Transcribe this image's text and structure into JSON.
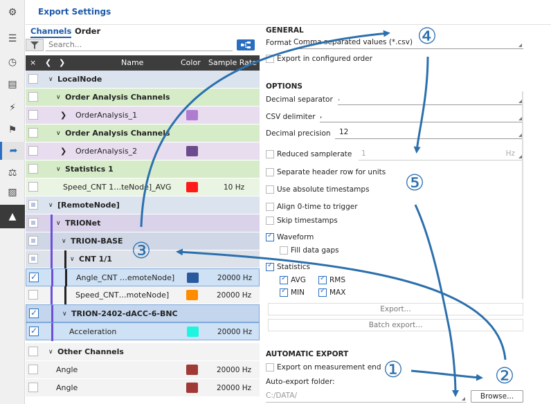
{
  "window": {
    "title": "Export Settings"
  },
  "sidebar": {
    "icons": [
      "gear-icon",
      "list-icon",
      "gauge-icon",
      "document-icon",
      "lightning-icon",
      "flag-icon",
      "export-icon",
      "network-icon",
      "car-icon",
      "triangle-icon"
    ]
  },
  "tabs": {
    "channels": "Channels",
    "order": "Order"
  },
  "search": {
    "placeholder": "Search..."
  },
  "table": {
    "headers": {
      "clear": "×",
      "name": "Name",
      "color": "Color",
      "rate": "Sample Rate"
    },
    "rows": [
      {
        "label": "LocalNode",
        "bold": true
      },
      {
        "label": "Order Analysis Channels",
        "bold": true
      },
      {
        "label": "OrderAnalysis_1",
        "color": "#b07cd0"
      },
      {
        "label": "Order Analysis Channels",
        "bold": true
      },
      {
        "label": "OrderAnalysis_2",
        "color": "#6b4a8e"
      },
      {
        "label": "Statistics 1",
        "bold": true
      },
      {
        "label": "Speed_CNT 1…teNode]_AVG",
        "color": "#ff1a1a",
        "rate": "10 Hz"
      },
      {
        "label": "[RemoteNode]",
        "bold": true
      },
      {
        "label": "TRIONet",
        "bold": true
      },
      {
        "label": "TRION-BASE",
        "bold": true
      },
      {
        "label": "CNT 1/1",
        "bold": true
      },
      {
        "label": "Angle_CNT …emoteNode]",
        "color": "#2a5a9e",
        "rate": "20000 Hz"
      },
      {
        "label": "Speed_CNT…moteNode]",
        "color": "#ff8c00",
        "rate": "20000 Hz"
      },
      {
        "label": "TRION-2402-dACC-6-BNC",
        "bold": true
      },
      {
        "label": "Acceleration",
        "color": "#1ef5e0",
        "rate": "20000 Hz"
      },
      {
        "label": "Other Channels",
        "bold": true
      },
      {
        "label": "Angle",
        "color": "#a03a36",
        "rate": "20000 Hz"
      },
      {
        "label": "Angle",
        "color": "#a03a36",
        "rate": "20000 Hz"
      }
    ]
  },
  "general": {
    "heading": "GENERAL",
    "format_label": "Format",
    "format_value": "Comma separated values (*.csv)",
    "export_order": "Export in configured order"
  },
  "options": {
    "heading": "OPTIONS",
    "decimal_separator_label": "Decimal separator",
    "decimal_separator_value": ".",
    "csv_delimiter_label": "CSV delimiter",
    "csv_delimiter_value": ",",
    "decimal_precision_label": "Decimal precision",
    "decimal_precision_value": "12",
    "reduced_samplerate": "Reduced samplerate",
    "reduced_value": "1",
    "reduced_unit": "Hz",
    "separate_header": "Separate header row for units",
    "absolute_ts": "Use absolute timestamps",
    "align_zero": "Align 0-time to trigger",
    "skip_ts": "Skip timestamps",
    "waveform": "Waveform",
    "fill_gaps": "Fill data gaps",
    "statistics": "Statistics",
    "avg": "AVG",
    "rms": "RMS",
    "min": "MIN",
    "max": "MAX",
    "export_btn": "Export...",
    "batch_btn": "Batch export..."
  },
  "auto_export": {
    "heading": "AUTOMATIC EXPORT",
    "on_end": "Export on measurement end",
    "folder_label": "Auto-export folder:",
    "folder_value": "C:/DATA/",
    "browse": "Browse..."
  },
  "callouts": [
    "①",
    "②",
    "③",
    "④",
    "⑤"
  ],
  "accent": "#2b6fad"
}
